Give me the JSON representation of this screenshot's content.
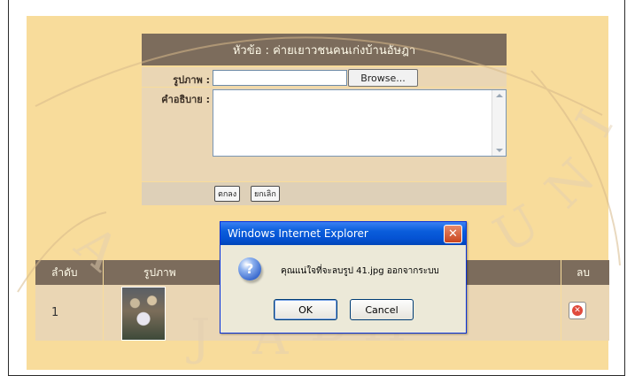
{
  "form": {
    "title": "หัวข้อ : ค่ายเยาวชนคนเก่งบ้านอัษฎา",
    "image_label": "รูปภาพ :",
    "image_value": "",
    "browse_label": "Browse...",
    "description_label": "คำอธิบาย :",
    "description_value": "",
    "ok_label": "ตกลง",
    "cancel_label": "ยกเลิก"
  },
  "table": {
    "headers": [
      "ลำดับ",
      "รูปภาพ",
      "ลบ"
    ],
    "rows": [
      {
        "index": "1"
      }
    ]
  },
  "dialog": {
    "title": "Windows Internet Explorer",
    "message": "คุณแน่ใจที่จะลบรูป 41.jpg  ออกจากระบบ",
    "ok": "OK",
    "cancel": "Cancel"
  },
  "watermark": {
    "letters": [
      "A",
      "J",
      "A",
      "B",
      "H",
      "A",
      "T",
      "U",
      "N",
      "I"
    ]
  },
  "colors": {
    "page_bg": "#f8dc9b",
    "header_bg": "#7c6c5c",
    "row_bg": "#ead6b4",
    "dialog_title": "#0a5ddb"
  }
}
